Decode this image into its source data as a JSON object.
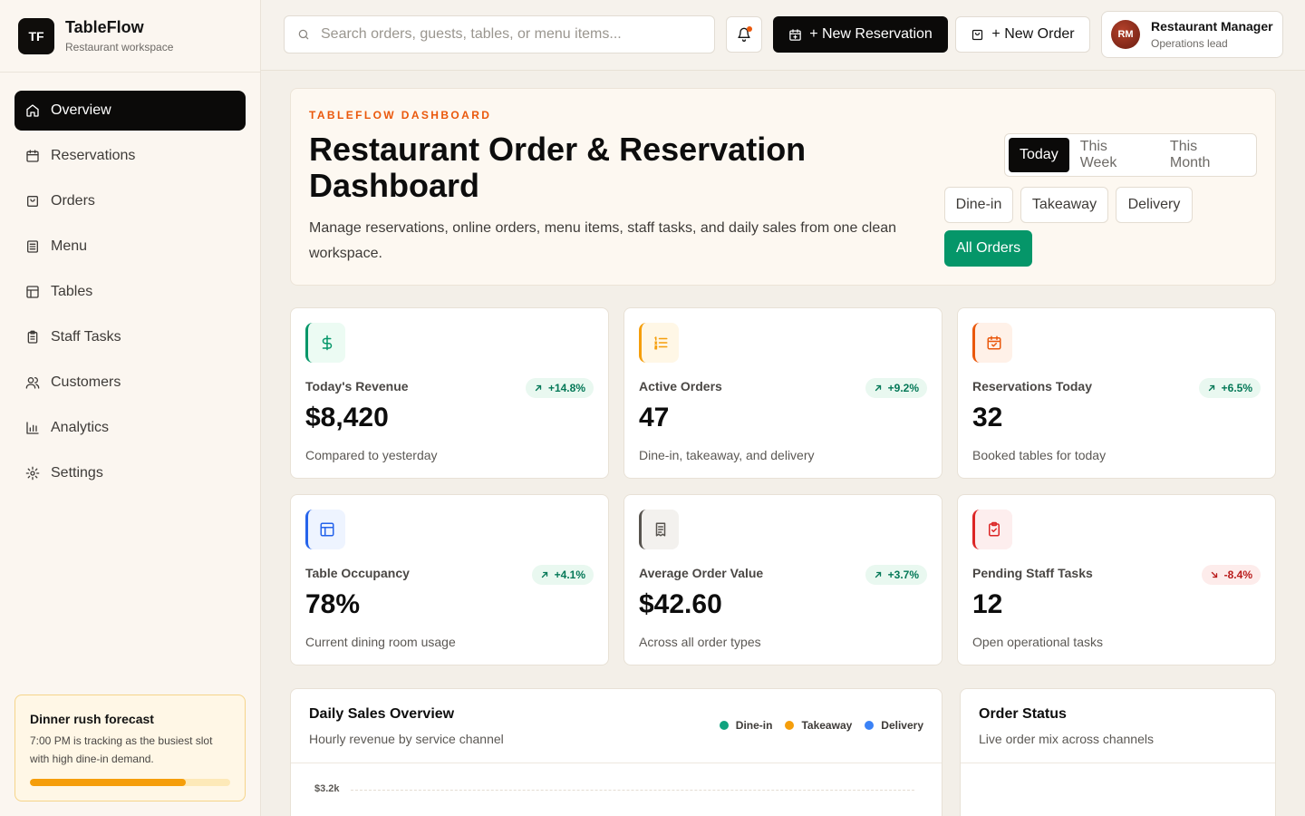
{
  "brand": {
    "logo": "TF",
    "name": "TableFlow",
    "subtitle": "Restaurant workspace"
  },
  "nav": [
    {
      "label": "Overview",
      "icon": "home-icon",
      "active": true
    },
    {
      "label": "Reservations",
      "icon": "calendar-icon"
    },
    {
      "label": "Orders",
      "icon": "shopping-bag-icon"
    },
    {
      "label": "Menu",
      "icon": "menu-list-icon"
    },
    {
      "label": "Tables",
      "icon": "table-grid-icon"
    },
    {
      "label": "Staff Tasks",
      "icon": "clipboard-icon"
    },
    {
      "label": "Customers",
      "icon": "users-icon"
    },
    {
      "label": "Analytics",
      "icon": "bar-chart-icon"
    },
    {
      "label": "Settings",
      "icon": "gear-icon"
    }
  ],
  "forecast": {
    "title": "Dinner rush forecast",
    "text": "7:00 PM is tracking as the busiest slot with high dine-in demand.",
    "progress": 0.78
  },
  "topbar": {
    "search_placeholder": "Search orders, guests, tables, or menu items...",
    "new_reservation": "+ New Reservation",
    "new_order": "+ New Order",
    "profile": {
      "initials": "RM",
      "name": "Restaurant Manager",
      "role": "Operations lead"
    }
  },
  "hero": {
    "eyebrow": "TABLEFLOW DASHBOARD",
    "title": "Restaurant Order & Reservation Dashboard",
    "description": "Manage reservations, online orders, menu items, staff tasks, and daily sales from one clean workspace.",
    "periods": [
      "Today",
      "This Week",
      "This Month"
    ],
    "active_period": "Today",
    "order_filters": [
      "Dine-in",
      "Takeaway",
      "Delivery",
      "All Orders"
    ],
    "active_filter": "All Orders"
  },
  "kpis": [
    {
      "label": "Today's Revenue",
      "value": "$8,420",
      "change": "+14.8%",
      "trend": "up",
      "sub": "Compared to yesterday",
      "icon": "dollar-icon",
      "color": "#059669",
      "bg": "#ecfbf3"
    },
    {
      "label": "Active Orders",
      "value": "47",
      "change": "+9.2%",
      "trend": "up",
      "sub": "Dine-in, takeaway, and delivery",
      "icon": "list-ordered-icon",
      "color": "#f59e0b",
      "bg": "#fff7e6"
    },
    {
      "label": "Reservations Today",
      "value": "32",
      "change": "+6.5%",
      "trend": "up",
      "sub": "Booked tables for today",
      "icon": "calendar-check-icon",
      "color": "#ea580c",
      "bg": "#fff1e8"
    },
    {
      "label": "Table Occupancy",
      "value": "78%",
      "change": "+4.1%",
      "trend": "up",
      "sub": "Current dining room usage",
      "icon": "table-grid-icon",
      "color": "#2563eb",
      "bg": "#eef4ff"
    },
    {
      "label": "Average Order Value",
      "value": "$42.60",
      "change": "+3.7%",
      "trend": "up",
      "sub": "Across all order types",
      "icon": "receipt-icon",
      "color": "#57534e",
      "bg": "#f3f1ee"
    },
    {
      "label": "Pending Staff Tasks",
      "value": "12",
      "change": "-8.4%",
      "trend": "down",
      "sub": "Open operational tasks",
      "icon": "clipboard-check-icon",
      "color": "#dc2626",
      "bg": "#fdeeee"
    }
  ],
  "sales_panel": {
    "title": "Daily Sales Overview",
    "subtitle": "Hourly revenue by service channel",
    "legend": [
      {
        "name": "Dine-in",
        "color": "#10a37f"
      },
      {
        "name": "Takeaway",
        "color": "#f59e0b"
      },
      {
        "name": "Delivery",
        "color": "#3b82f6"
      }
    ],
    "y_tick_top": "$3.2k"
  },
  "status_panel": {
    "title": "Order Status",
    "subtitle": "Live order mix across channels"
  }
}
